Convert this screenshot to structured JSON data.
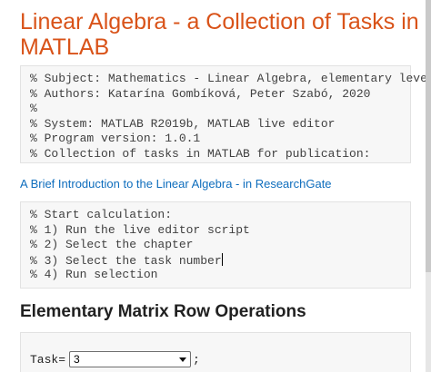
{
  "title": "Linear Algebra - a Collection of Tasks in MATLAB",
  "header_comments": [
    "% Subject: Mathematics - Linear Algebra, elementary level",
    "% Authors: Katarína Gombíková, Peter Szabó, 2020",
    "%",
    "% System: MATLAB R2019b, MATLAB live editor",
    "% Program version: 1.0.1",
    "% Collection of tasks in MATLAB for publication:"
  ],
  "link_text": "A Brief Introduction to the Linear Algebra - in ResearchGate",
  "instructions": [
    "% Start calculation:",
    "% 1) Run the live editor script",
    "% 2) Select the chapter",
    "% 3) Select the task number",
    "% 4) Run selection"
  ],
  "section_heading": "Elementary Matrix Row Operations",
  "task_control": {
    "label": "Task=",
    "selected_value": "3",
    "suffix": ";"
  },
  "colors": {
    "title": "#d95319",
    "link": "#0e6dbd",
    "code_background": "#f7f7f7"
  },
  "icons": {
    "dropdown": "chevron-down-icon"
  }
}
